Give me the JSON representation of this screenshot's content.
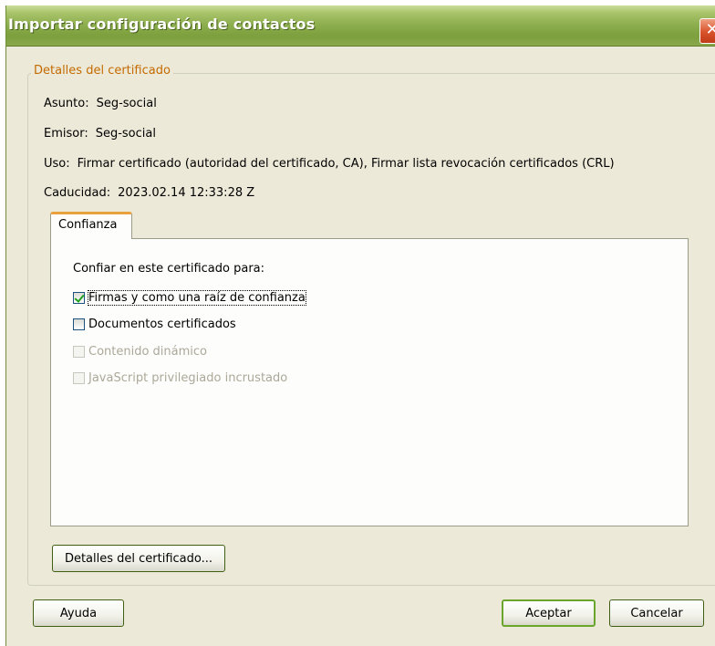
{
  "window": {
    "title": "Importar configuración de contactos",
    "close_glyph": "✕"
  },
  "details_group": {
    "legend": "Detalles del certificado",
    "fields": [
      {
        "label": "Asunto:",
        "value": "Seg-social"
      },
      {
        "label": "Emisor:",
        "value": "Seg-social"
      },
      {
        "label": "Uso:",
        "value": "Firmar certificado (autoridad del certificado, CA), Firmar lista revocación certificados (CRL)"
      },
      {
        "label": "Caducidad:",
        "value": "2023.02.14 12:33:28 Z"
      }
    ]
  },
  "trust_tab": {
    "tab_label": "Confianza",
    "heading": "Confiar en este certificado para:",
    "options": [
      {
        "label": "Firmas y como una raíz de confianza",
        "checked": true,
        "enabled": true
      },
      {
        "label": "Documentos certificados",
        "checked": false,
        "enabled": true
      },
      {
        "label": "Contenido dinámico",
        "checked": false,
        "enabled": false
      },
      {
        "label": "JavaScript privilegiado incrustado",
        "checked": false,
        "enabled": false
      }
    ]
  },
  "buttons": {
    "cert_details": "Detalles del certificado...",
    "help": "Ayuda",
    "accept": "Aceptar",
    "cancel": "Cancelar"
  }
}
